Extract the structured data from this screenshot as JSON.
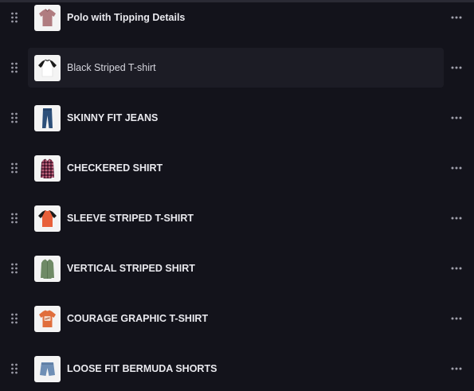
{
  "products": [
    {
      "title": "Polo with Tipping Details",
      "thumb_icon": "polo-shirt-icon",
      "garment_color": "#b07c80",
      "hovered": false
    },
    {
      "title": "Black Striped T-shirt",
      "thumb_icon": "raglan-tshirt-icon",
      "garment_color": "#ffffff",
      "hovered": true
    },
    {
      "title": "SKINNY FIT JEANS",
      "thumb_icon": "jeans-icon",
      "garment_color": "#2c4f79",
      "hovered": false
    },
    {
      "title": "CHECKERED SHIRT",
      "thumb_icon": "checkered-shirt-icon",
      "garment_color": "#7a2a45",
      "hovered": false
    },
    {
      "title": "SLEEVE STRIPED T-SHIRT",
      "thumb_icon": "tshirt-icon",
      "garment_color": "#e8603a",
      "hovered": false
    },
    {
      "title": "VERTICAL STRIPED SHIRT",
      "thumb_icon": "shirt-icon",
      "garment_color": "#6f8a66",
      "hovered": false
    },
    {
      "title": "COURAGE GRAPHIC T-SHIRT",
      "thumb_icon": "graphic-tshirt-icon",
      "garment_color": "#e06e3c",
      "hovered": false
    },
    {
      "title": "LOOSE FIT BERMUDA SHORTS",
      "thumb_icon": "shorts-icon",
      "garment_color": "#6f8fb5",
      "hovered": false
    }
  ],
  "row_actions_icon": "more-horizontal-icon",
  "drag_handle_icon": "drag-handle-icon"
}
